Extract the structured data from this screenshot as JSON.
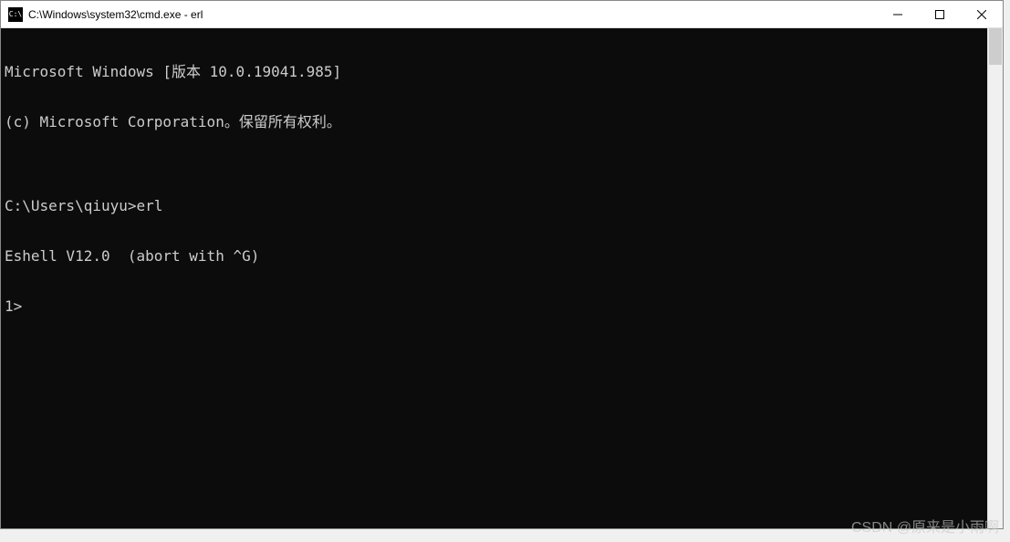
{
  "window": {
    "icon_text": "C:\\",
    "title": "C:\\Windows\\system32\\cmd.exe - erl"
  },
  "terminal": {
    "lines": [
      "Microsoft Windows [版本 10.0.19041.985]",
      "(c) Microsoft Corporation。保留所有权利。",
      "",
      "C:\\Users\\qiuyu>erl",
      "Eshell V12.0  (abort with ^G)",
      "1>"
    ]
  },
  "watermark": "CSDN @原来是小雨啊"
}
